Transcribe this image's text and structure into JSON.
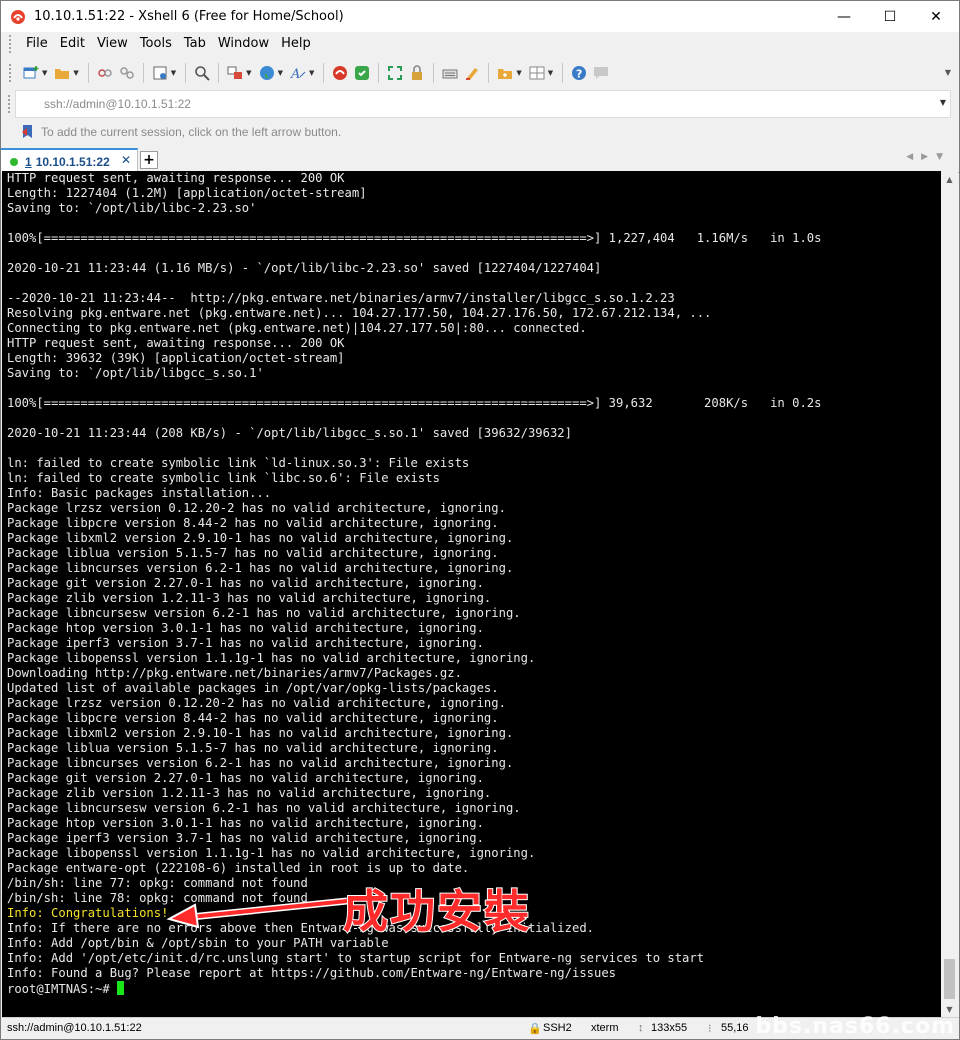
{
  "window": {
    "title": "10.10.1.51:22 - Xshell 6 (Free for Home/School)",
    "minimize": "—",
    "maximize": "☐",
    "close": "✕"
  },
  "menu": [
    "File",
    "Edit",
    "View",
    "Tools",
    "Tab",
    "Window",
    "Help"
  ],
  "toolbar": {
    "icons": [
      "new-session-icon",
      "open-folder-icon",
      "disconnect-icon",
      "reconnect-icon",
      "properties-icon",
      "find-icon",
      "transfer-icon",
      "globe-icon",
      "font-icon",
      "xftp-icon",
      "xshell-icon",
      "fullscreen-icon",
      "lock-icon",
      "keyboard-icon",
      "highlight-icon",
      "compose-icon",
      "layout-icon",
      "help-icon",
      "chat-icon"
    ]
  },
  "address": {
    "value": "ssh://admin@10.10.1.51:22"
  },
  "hint": {
    "text": "To add the current session, click on the left arrow button."
  },
  "tab": {
    "number": "1",
    "label": "10.10.1.51:22",
    "close": "✕",
    "add": "+"
  },
  "terminal": {
    "lines": [
      "HTTP request sent, awaiting response... 200 OK",
      "Length: 1227404 (1.2M) [application/octet-stream]",
      "Saving to: `/opt/lib/libc-2.23.so'",
      "",
      "100%[==========================================================================>] 1,227,404   1.16M/s   in 1.0s",
      "",
      "2020-10-21 11:23:44 (1.16 MB/s) - `/opt/lib/libc-2.23.so' saved [1227404/1227404]",
      "",
      "--2020-10-21 11:23:44--  http://pkg.entware.net/binaries/armv7/installer/libgcc_s.so.1.2.23",
      "Resolving pkg.entware.net (pkg.entware.net)... 104.27.177.50, 104.27.176.50, 172.67.212.134, ...",
      "Connecting to pkg.entware.net (pkg.entware.net)|104.27.177.50|:80... connected.",
      "HTTP request sent, awaiting response... 200 OK",
      "Length: 39632 (39K) [application/octet-stream]",
      "Saving to: `/opt/lib/libgcc_s.so.1'",
      "",
      "100%[==========================================================================>] 39,632       208K/s   in 0.2s",
      "",
      "2020-10-21 11:23:44 (208 KB/s) - `/opt/lib/libgcc_s.so.1' saved [39632/39632]",
      "",
      "ln: failed to create symbolic link `ld-linux.so.3': File exists",
      "ln: failed to create symbolic link `libc.so.6': File exists",
      "Info: Basic packages installation...",
      "Package lrzsz version 0.12.20-2 has no valid architecture, ignoring.",
      "Package libpcre version 8.44-2 has no valid architecture, ignoring.",
      "Package libxml2 version 2.9.10-1 has no valid architecture, ignoring.",
      "Package liblua version 5.1.5-7 has no valid architecture, ignoring.",
      "Package libncurses version 6.2-1 has no valid architecture, ignoring.",
      "Package git version 2.27.0-1 has no valid architecture, ignoring.",
      "Package zlib version 1.2.11-3 has no valid architecture, ignoring.",
      "Package libncursesw version 6.2-1 has no valid architecture, ignoring.",
      "Package htop version 3.0.1-1 has no valid architecture, ignoring.",
      "Package iperf3 version 3.7-1 has no valid architecture, ignoring.",
      "Package libopenssl version 1.1.1g-1 has no valid architecture, ignoring.",
      "Downloading http://pkg.entware.net/binaries/armv7/Packages.gz.",
      "Updated list of available packages in /opt/var/opkg-lists/packages.",
      "Package lrzsz version 0.12.20-2 has no valid architecture, ignoring.",
      "Package libpcre version 8.44-2 has no valid architecture, ignoring.",
      "Package libxml2 version 2.9.10-1 has no valid architecture, ignoring.",
      "Package liblua version 5.1.5-7 has no valid architecture, ignoring.",
      "Package libncurses version 6.2-1 has no valid architecture, ignoring.",
      "Package git version 2.27.0-1 has no valid architecture, ignoring.",
      "Package zlib version 1.2.11-3 has no valid architecture, ignoring.",
      "Package libncursesw version 6.2-1 has no valid architecture, ignoring.",
      "Package htop version 3.0.1-1 has no valid architecture, ignoring.",
      "Package iperf3 version 3.7-1 has no valid architecture, ignoring.",
      "Package libopenssl version 1.1.1g-1 has no valid architecture, ignoring.",
      "Package entware-opt (222108-6) installed in root is up to date.",
      "/bin/sh: line 77: opkg: command not found",
      "/bin/sh: line 78: opkg: command not found",
      "Info: Congratulations!",
      "Info: If there are no errors above then Entware-ng was successfully initialized.",
      "Info: Add /opt/bin & /opt/sbin to your PATH variable",
      "Info: Add '/opt/etc/init.d/rc.unslung start' to startup script for Entware-ng services to start",
      "Info: Found a Bug? Please report at https://github.com/Entware-ng/Entware-ng/issues"
    ],
    "highlight_line": "Info: Congratulations!",
    "highlight_color": "#f5e32a",
    "prompt": "root@IMTNAS:~# ",
    "cursor_color": "#19e619"
  },
  "annotation": {
    "text": "成功安裝",
    "color": "#ff2b2b"
  },
  "statusbar": {
    "address": "ssh://admin@10.10.1.51:22",
    "protocol": "SSH2",
    "terminal_type": "xterm",
    "size": "133x55",
    "cursor_pos": "55,16"
  },
  "watermark": "bbs.nas66.com"
}
